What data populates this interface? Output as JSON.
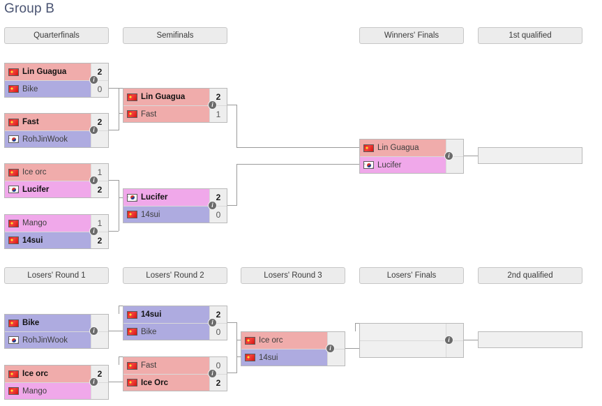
{
  "page": {
    "title": "Group B",
    "title_color": "#4a5472"
  },
  "colors": {
    "team_red": "#f0acab",
    "team_blue": "#aeabe0",
    "team_pink": "#f0a8ea",
    "header_bg": "#ececec",
    "line": "#9a9a9a"
  },
  "info_icon": "i",
  "rounds": {
    "quarterfinals": "Quarterfinals",
    "semifinals": "Semifinals",
    "winners_finals": "Winners' Finals",
    "first_qualified": "1st qualified",
    "losers_round_1": "Losers' Round 1",
    "losers_round_2": "Losers' Round 2",
    "losers_round_3": "Losers' Round 3",
    "losers_finals": "Losers' Finals",
    "second_qualified": "2nd qualified"
  },
  "matches": {
    "qf1": {
      "top": {
        "name": "Lin Guagua",
        "score": "2",
        "flag": "cn",
        "winner": true,
        "color": "red"
      },
      "bottom": {
        "name": "Bike",
        "score": "0",
        "flag": "cn",
        "winner": false,
        "color": "blue"
      }
    },
    "qf2": {
      "top": {
        "name": "Fast",
        "score": "2",
        "flag": "cn",
        "winner": true,
        "color": "red"
      },
      "bottom": {
        "name": "RohJinWook",
        "score": "",
        "flag": "kr",
        "winner": false,
        "color": "blue"
      }
    },
    "qf3": {
      "top": {
        "name": "Ice orc",
        "score": "1",
        "flag": "cn",
        "winner": false,
        "color": "red"
      },
      "bottom": {
        "name": "Lucifer",
        "score": "2",
        "flag": "kr",
        "winner": true,
        "color": "pink"
      }
    },
    "qf4": {
      "top": {
        "name": "Mango",
        "score": "1",
        "flag": "cn",
        "winner": false,
        "color": "pink"
      },
      "bottom": {
        "name": "14sui",
        "score": "2",
        "flag": "cn",
        "winner": true,
        "color": "blue"
      }
    },
    "sf1": {
      "top": {
        "name": "Lin Guagua",
        "score": "2",
        "flag": "cn",
        "winner": true,
        "color": "red"
      },
      "bottom": {
        "name": "Fast",
        "score": "1",
        "flag": "cn",
        "winner": false,
        "color": "red"
      }
    },
    "sf2": {
      "top": {
        "name": "Lucifer",
        "score": "2",
        "flag": "kr",
        "winner": true,
        "color": "pink"
      },
      "bottom": {
        "name": "14sui",
        "score": "0",
        "flag": "cn",
        "winner": false,
        "color": "blue"
      }
    },
    "wf": {
      "top": {
        "name": "Lin Guagua",
        "score": "",
        "flag": "cn",
        "winner": false,
        "color": "red"
      },
      "bottom": {
        "name": "Lucifer",
        "score": "",
        "flag": "kr",
        "winner": false,
        "color": "pink"
      }
    },
    "first_qualified_slot": {
      "top": {
        "name": "",
        "score": "",
        "flag": "",
        "winner": false,
        "color": "none"
      }
    },
    "lr1_1": {
      "top": {
        "name": "Bike",
        "score": "",
        "flag": "cn",
        "winner": true,
        "color": "blue"
      },
      "bottom": {
        "name": "RohJinWook",
        "score": "",
        "flag": "kr",
        "winner": false,
        "color": "blue"
      }
    },
    "lr1_2": {
      "top": {
        "name": "Ice orc",
        "score": "2",
        "flag": "cn",
        "winner": true,
        "color": "red"
      },
      "bottom": {
        "name": "Mango",
        "score": "",
        "flag": "cn",
        "winner": false,
        "color": "pink"
      }
    },
    "lr2_1": {
      "top": {
        "name": "14sui",
        "score": "2",
        "flag": "cn",
        "winner": true,
        "color": "blue"
      },
      "bottom": {
        "name": "Bike",
        "score": "0",
        "flag": "cn",
        "winner": false,
        "color": "blue"
      }
    },
    "lr2_2": {
      "top": {
        "name": "Fast",
        "score": "0",
        "flag": "cn",
        "winner": false,
        "color": "red"
      },
      "bottom": {
        "name": "Ice Orc",
        "score": "2",
        "flag": "cn",
        "winner": true,
        "color": "red"
      }
    },
    "lr3": {
      "top": {
        "name": "Ice orc",
        "score": "",
        "flag": "cn",
        "winner": false,
        "color": "red"
      },
      "bottom": {
        "name": "14sui",
        "score": "",
        "flag": "cn",
        "winner": false,
        "color": "blue"
      }
    },
    "lf": {
      "top": {
        "name": "",
        "score": "",
        "flag": "",
        "winner": false,
        "color": "none"
      },
      "bottom": {
        "name": "",
        "score": "",
        "flag": "",
        "winner": false,
        "color": "none"
      }
    },
    "second_qualified_slot": {
      "top": {
        "name": "",
        "score": "",
        "flag": "",
        "winner": false,
        "color": "none"
      }
    }
  }
}
